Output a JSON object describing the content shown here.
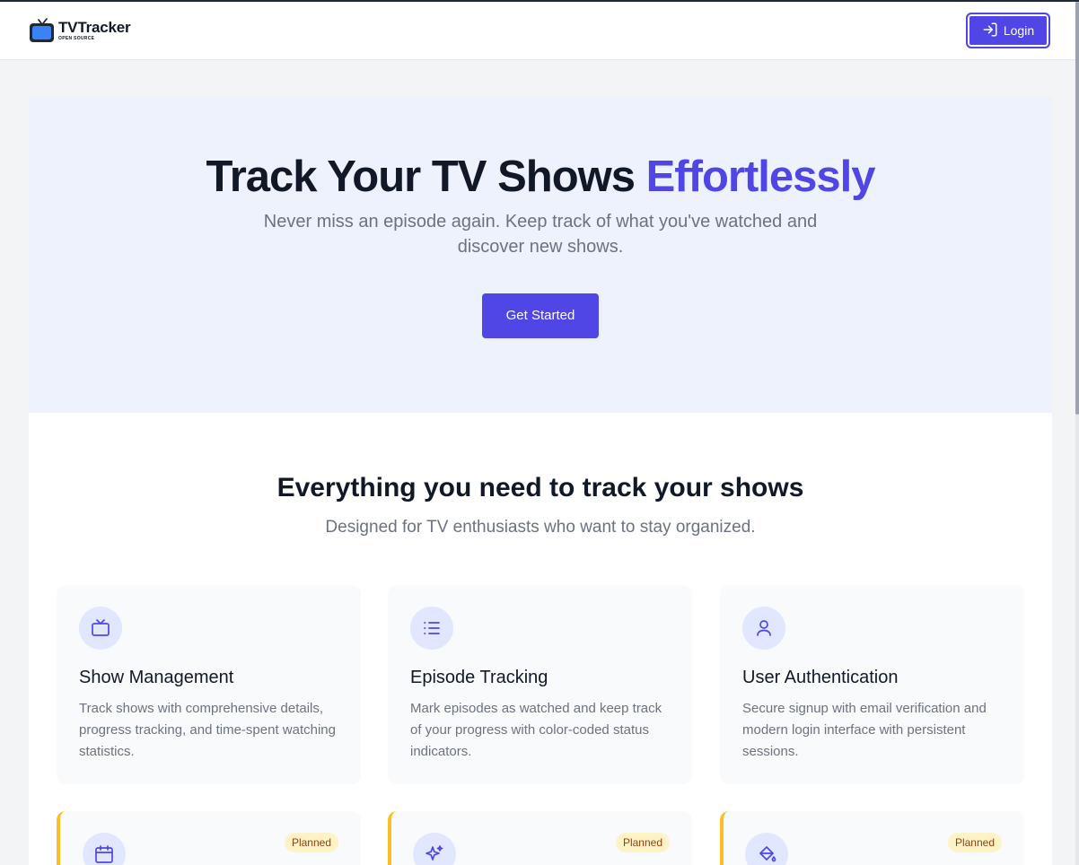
{
  "header": {
    "logo_name": "TVTracker",
    "logo_sub": "OPEN SOURCE",
    "login_label": "Login"
  },
  "hero": {
    "title_main": "Track Your TV Shows",
    "title_accent": "Effortlessly",
    "subtitle": "Never miss an episode again. Keep track of what you've watched and discover new shows.",
    "cta_label": "Get Started"
  },
  "features": {
    "title": "Everything you need to track your shows",
    "subtitle": "Designed for TV enthusiasts who want to stay organized.",
    "cards": [
      {
        "icon": "tv-icon",
        "title": "Show Management",
        "description": "Track shows with comprehensive details, progress tracking, and time-spent watching statistics."
      },
      {
        "icon": "list-icon",
        "title": "Episode Tracking",
        "description": "Mark episodes as watched and keep track of your progress with color-coded status indicators."
      },
      {
        "icon": "user-icon",
        "title": "User Authentication",
        "description": "Secure signup with email verification and modern login interface with persistent sessions."
      }
    ],
    "planned_cards": [
      {
        "icon": "calendar-icon",
        "badge": "Planned"
      },
      {
        "icon": "sparkles-icon",
        "badge": "Planned"
      },
      {
        "icon": "paint-bucket-icon",
        "badge": "Planned"
      }
    ]
  },
  "colors": {
    "accent": "#4f46e5",
    "hero_bg": "#eef2fc",
    "planned_border": "#fbbf24",
    "badge_bg": "#fef3c7"
  }
}
